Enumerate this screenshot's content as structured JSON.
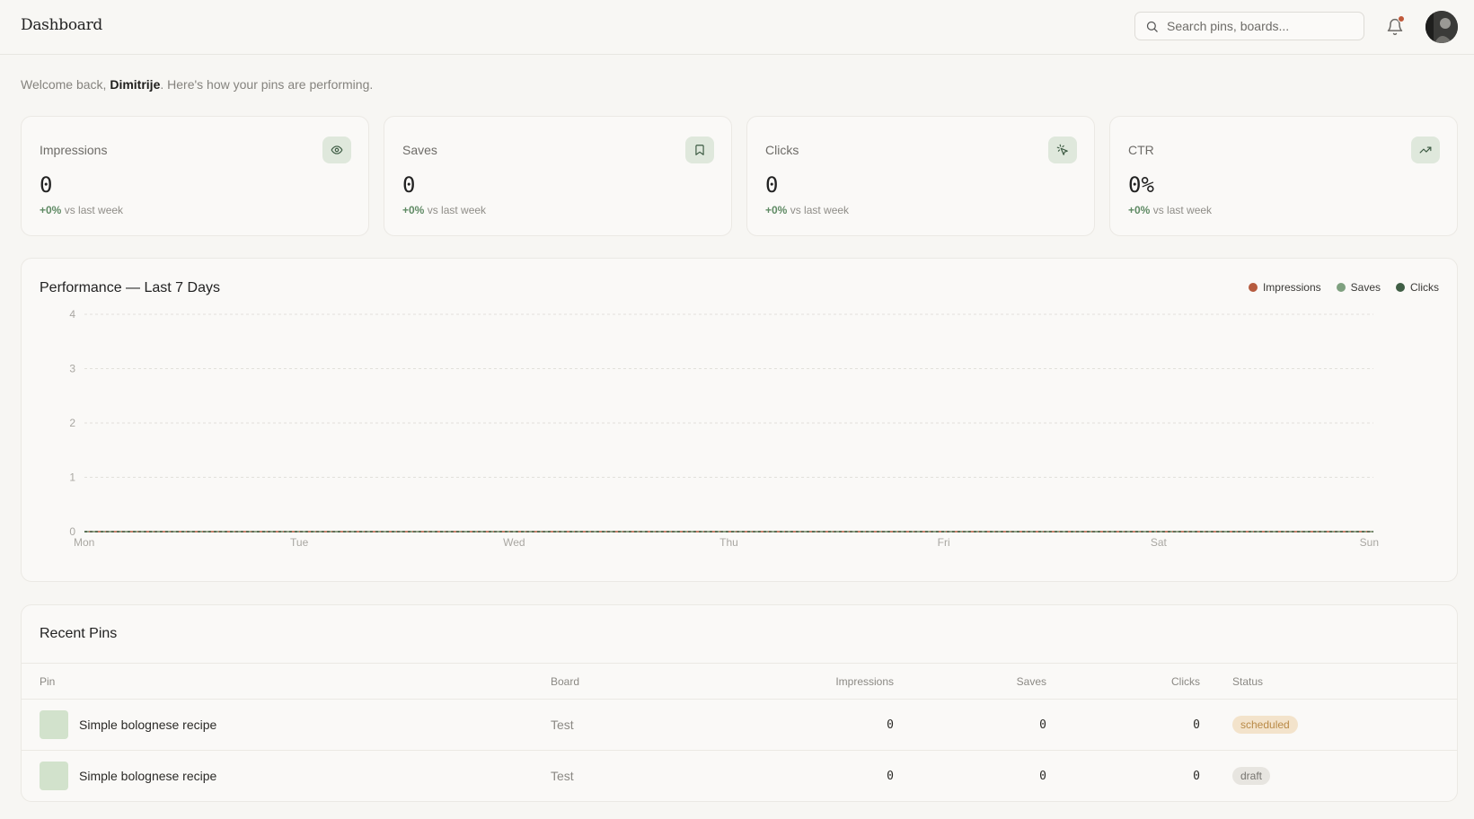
{
  "header": {
    "title": "Dashboard",
    "search_placeholder": "Search pins, boards...",
    "notification_dot_color": "#c0593a"
  },
  "welcome": {
    "prefix": "Welcome back, ",
    "name": "Dimitrije",
    "suffix": ". Here's how your pins are performing."
  },
  "stats": [
    {
      "label": "Impressions",
      "value": "0",
      "delta": "+0%",
      "delta_suffix": " vs last week",
      "icon": "eye-icon"
    },
    {
      "label": "Saves",
      "value": "0",
      "delta": "+0%",
      "delta_suffix": " vs last week",
      "icon": "bookmark-icon"
    },
    {
      "label": "Clicks",
      "value": "0",
      "delta": "+0%",
      "delta_suffix": " vs last week",
      "icon": "pointer-click-icon"
    },
    {
      "label": "CTR",
      "value": "0%",
      "delta": "+0%",
      "delta_suffix": " vs last week",
      "icon": "trending-up-icon"
    }
  ],
  "performance": {
    "title": "Performance — Last 7 Days",
    "chart_data": {
      "type": "line",
      "title": "Performance — Last 7 Days",
      "categories": [
        "Mon",
        "Tue",
        "Wed",
        "Thu",
        "Fri",
        "Sat",
        "Sun"
      ],
      "yticks": [
        0,
        1,
        2,
        3,
        4
      ],
      "ylim": [
        0,
        4
      ],
      "grid": true,
      "legend_position": "top-right",
      "series": [
        {
          "name": "Impressions",
          "color": "#b65b3f",
          "values": [
            0,
            0,
            0,
            0,
            0,
            0,
            0
          ]
        },
        {
          "name": "Saves",
          "color": "#7ea07f",
          "values": [
            0,
            0,
            0,
            0,
            0,
            0,
            0
          ]
        },
        {
          "name": "Clicks",
          "color": "#3f5e45",
          "values": [
            0,
            0,
            0,
            0,
            0,
            0,
            0
          ]
        }
      ]
    }
  },
  "recent_pins": {
    "title": "Recent Pins",
    "columns": [
      "Pin",
      "Board",
      "Impressions",
      "Saves",
      "Clicks",
      "Status"
    ],
    "rows": [
      {
        "pin": "Simple bolognese recipe",
        "board": "Test",
        "impressions": "0",
        "saves": "0",
        "clicks": "0",
        "status": "scheduled"
      },
      {
        "pin": "Simple bolognese recipe",
        "board": "Test",
        "impressions": "0",
        "saves": "0",
        "clicks": "0",
        "status": "draft"
      }
    ]
  }
}
